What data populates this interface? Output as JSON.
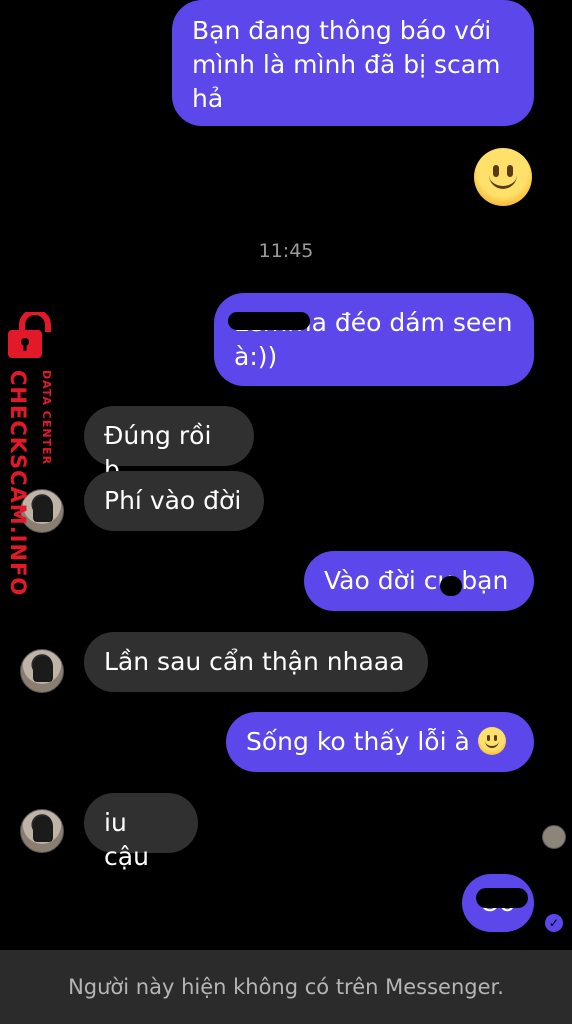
{
  "messages": {
    "m1": "Bạn đang thông báo với mình là mình đã bị scam hả",
    "timestamp": "11:45",
    "m2": "Lemma đéo dám seen à:))",
    "m3": "Đúng rồi b",
    "m4": "Phí vào đời",
    "m5": "Vào đời cụ bạn",
    "m6": "Lần sau cẩn thận nhaaa",
    "m7": "Sống ko thấy lỗi à",
    "m8": "iu cậu",
    "m9": "Oo"
  },
  "footer": {
    "status_text": "Người này hiện không có trên Messenger."
  },
  "watermark": {
    "brand": "CHECKSCAM.INFO",
    "sub": "DATA CENTER"
  },
  "colors": {
    "outgoing_bubble": "#5b47ea",
    "incoming_bubble": "#303030",
    "watermark_red": "#e3192a"
  },
  "icons": {
    "emoji": "slightly-smiling-face-icon",
    "seen": "avatar-seen-indicator",
    "sent": "check-circle-icon"
  }
}
